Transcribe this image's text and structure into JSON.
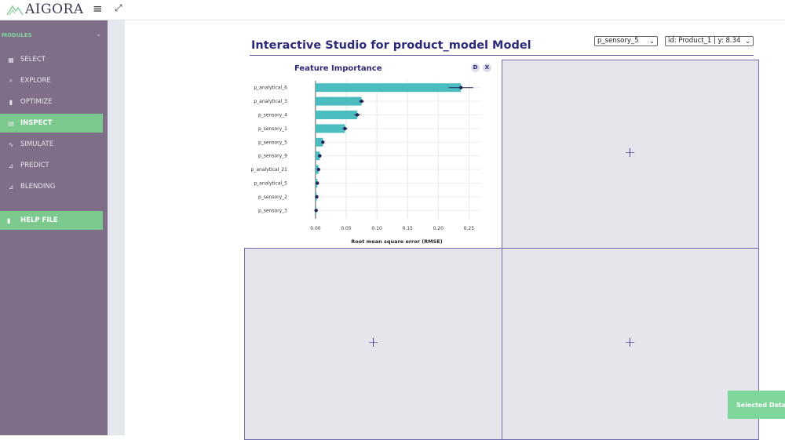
{
  "app": {
    "logo_text": "AIGORA"
  },
  "topbar": {
    "menu_icon": "hamburger-icon",
    "fullscreen_icon": "expand-icon"
  },
  "sidebar": {
    "modules_label": "MODULES",
    "items": [
      {
        "label": "SELECT",
        "icon": "grid-icon"
      },
      {
        "label": "EXPLORE",
        "icon": "search-icon"
      },
      {
        "label": "OPTIMIZE",
        "icon": "bar-chart-icon"
      },
      {
        "label": "INSPECT",
        "icon": "inspect-icon"
      },
      {
        "label": "SIMULATE",
        "icon": "pulse-icon"
      },
      {
        "label": "PREDICT",
        "icon": "line-chart-icon"
      },
      {
        "label": "BLENDING",
        "icon": "area-chart-icon"
      }
    ],
    "active_item": "INSPECT",
    "help_label": "HELP FILE"
  },
  "main": {
    "title": "Interactive Studio for product_model Model",
    "select_variable": "p_sensory_5",
    "select_product": "id: Product_1 | y: 8.34",
    "chart_buttons": {
      "download": "D",
      "close": "X"
    }
  },
  "toast": {
    "label": "Selected Data"
  },
  "colors": {
    "bar": "#4bbdc1",
    "accent": "#2d2a78",
    "sidebar": "#7e6e88",
    "active": "#7cc98d"
  },
  "chart_data": {
    "type": "bar",
    "orientation": "horizontal",
    "title": "Feature Importance",
    "xlabel": "Root mean square error (RMSE)",
    "ylabel": "",
    "categories": [
      "p_analytical_6",
      "p_analytical_3",
      "p_sensory_4",
      "p_sensory_1",
      "p_sensory_5",
      "p_sensory_9",
      "p_analytical_21",
      "p_analytical_5",
      "p_sensory_2",
      "p_sensory_3"
    ],
    "values": [
      0.237,
      0.075,
      0.068,
      0.048,
      0.012,
      0.007,
      0.005,
      0.003,
      0.002,
      0.001
    ],
    "errors": [
      0.02,
      0.004,
      0.005,
      0.004,
      0.002,
      0.001,
      0.001,
      0.001,
      0.0005,
      0.0005
    ],
    "xlim": [
      -0.005,
      0.27
    ],
    "xticks": [
      0.0,
      0.05,
      0.1,
      0.15,
      0.2,
      0.25
    ],
    "xtick_labels": [
      "0.00",
      "0.05",
      "0.10",
      "0.15",
      "0.20",
      "0.25"
    ],
    "grid": true
  }
}
